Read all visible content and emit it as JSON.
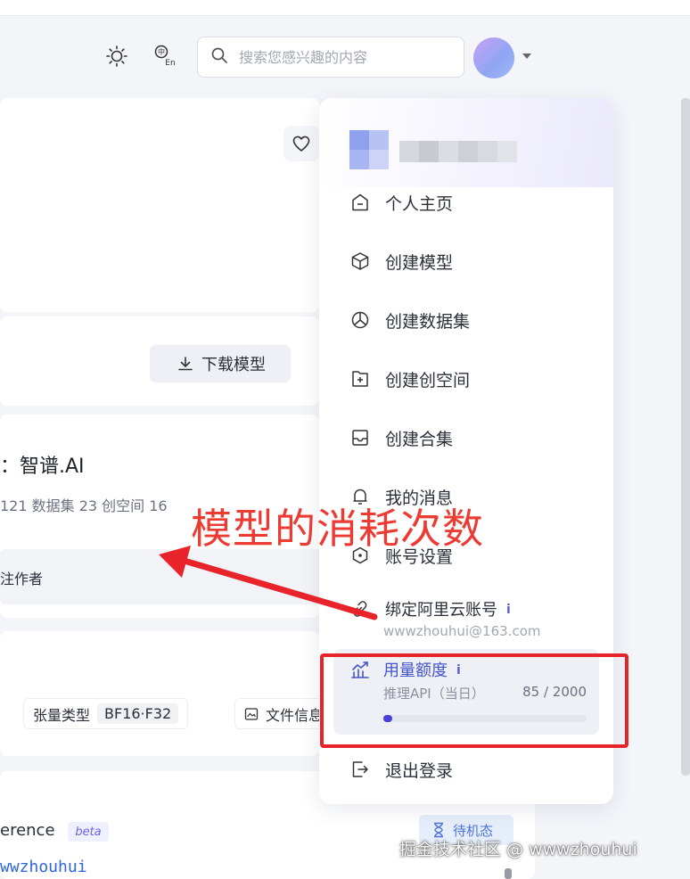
{
  "header": {
    "search_placeholder": "搜索您感兴趣的内容",
    "icons": [
      "sun-icon",
      "language-icon",
      "search-icon",
      "chevron-down-icon"
    ]
  },
  "page": {
    "download_label": "下载模型",
    "org_title": "：智谱.AI",
    "org_stats": "121 数据集 23 创空间 16",
    "follow_text": "注作者",
    "tensor_type_label": "张量类型",
    "tensor_type_value": "BF16·F32",
    "file_info_label": "文件信息",
    "inference_text": "erence",
    "beta_label": "beta",
    "username_fragment": "wwzhouhui",
    "standby_label": "待机态"
  },
  "menu": {
    "items": [
      {
        "label": "个人主页",
        "icon": "home-icon"
      },
      {
        "label": "创建模型",
        "icon": "cube-icon"
      },
      {
        "label": "创建数据集",
        "icon": "pie-chart-icon"
      },
      {
        "label": "创建创空间",
        "icon": "add-folder-icon"
      },
      {
        "label": "创建合集",
        "icon": "inbox-icon"
      },
      {
        "label": "我的消息",
        "icon": "bell-icon"
      },
      {
        "label": "账号设置",
        "icon": "hexagon-settings-icon"
      },
      {
        "label": "绑定阿里云账号",
        "icon": "link-icon"
      }
    ],
    "info_mark": "i",
    "email": "wwwzhouhui@163.com",
    "quota": {
      "title": "用量额度",
      "sub_label": "推理API（当日）",
      "used": 85,
      "total": 2000,
      "value_text": "85 / 2000",
      "fraction": 0.0425
    },
    "logout_label": "退出登录"
  },
  "annotation": {
    "text": "模型的消耗次数",
    "color": "#ec3b33"
  },
  "watermark": "掘金技术社区 @ wwwzhouhui",
  "colors": {
    "accent": "#4a3fd6",
    "quota_title": "#4254c8",
    "annotation_red": "#e8232a",
    "standby_blue": "#4d74d8"
  }
}
